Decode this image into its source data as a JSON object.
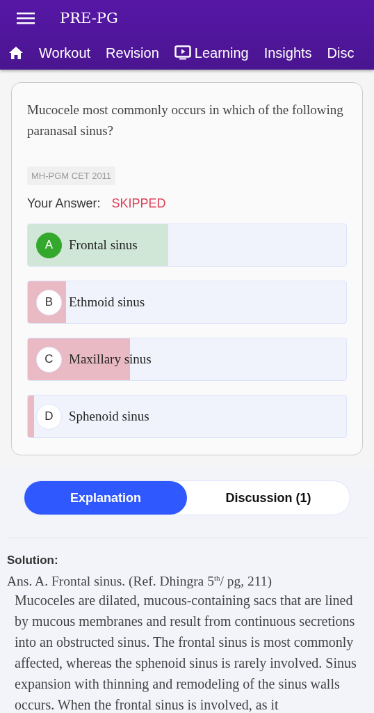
{
  "app_bar": {
    "title": "PRE-PG"
  },
  "nav_tabs": [
    {
      "label": "Workout",
      "kind": "plain"
    },
    {
      "label": "Revision",
      "kind": "plain"
    },
    {
      "label": "Learning",
      "kind": "media"
    },
    {
      "label": "Insights",
      "kind": "plain"
    },
    {
      "label": "Disc",
      "kind": "plain"
    }
  ],
  "question": {
    "text": "Mucocele most commonly occurs in which of the following paranasal sinus?",
    "tag": "MH-PGM CET 2011",
    "answer_label": "Your Answer:",
    "answer_value": "SKIPPED",
    "options": [
      {
        "letter": "A",
        "text": "Frontal sinus",
        "correct": true,
        "level": 0.44
      },
      {
        "letter": "B",
        "text": "Ethmoid sinus",
        "correct": false,
        "level": 0.12
      },
      {
        "letter": "C",
        "text": "Maxillary sinus",
        "correct": false,
        "level": 0.32
      },
      {
        "letter": "D",
        "text": "Sphenoid sinus",
        "correct": false,
        "level": 0.02
      }
    ]
  },
  "toggle": [
    {
      "label": "Explanation",
      "selected": true
    },
    {
      "label": "Discussion (1)",
      "selected": false
    }
  ],
  "solution": {
    "heading": "Solution:",
    "answer": "Ans. A. Frontal sinus. (Ref. Dhingra 5$^{th}$/ pg, 211)",
    "body": "Mucoceles are dilated, mucous-containing sacs that are lined by mucous membranes and result from continuous secretions into an obstructed sinus. The frontal sinus is most commonly affected, whereas the sphenoid sinus is rarely involved. Sinus expansion with thinning and remodeling of the sinus walls occurs. When the frontal sinus is involved, as it"
  }
}
